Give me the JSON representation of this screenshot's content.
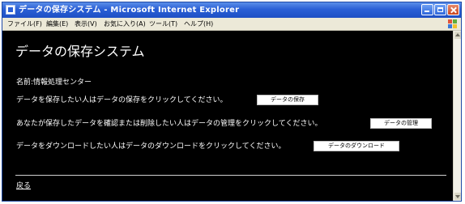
{
  "window": {
    "title": "データの保存システム - Microsoft Internet Explorer"
  },
  "menu": {
    "items": [
      {
        "label": "ファイル(F)"
      },
      {
        "label": "編集(E)"
      },
      {
        "label": "表示(V)"
      },
      {
        "label": "お気に入り(A)"
      },
      {
        "label": "ツール(T)"
      },
      {
        "label": "ヘルプ(H)"
      }
    ]
  },
  "page": {
    "heading": "データの保存システム",
    "name_line": "名前:情報処理センター",
    "rows": [
      {
        "text": "データを保存したい人はデータの保存をクリックしてください。",
        "button": "データの保存"
      },
      {
        "text": "あなたが保存したデータを確認または削除したい人はデータの管理をクリックしてください。",
        "button": "データの管理"
      },
      {
        "text": "データをダウンロードしたい人はデータのダウンロードをクリックしてください。",
        "button": "データのダウンロード"
      }
    ],
    "back_link": "戻る"
  },
  "colors": {
    "titlebar": "#2a5fd6",
    "content_background": "#000000",
    "content_text": "#ffffff",
    "button_background": "#ffffff"
  },
  "icons": [
    "ie-app-icon",
    "minimize-icon",
    "maximize-icon",
    "close-icon",
    "windows-logo-icon",
    "scroll-up-arrow-icon",
    "scroll-down-arrow-icon"
  ]
}
